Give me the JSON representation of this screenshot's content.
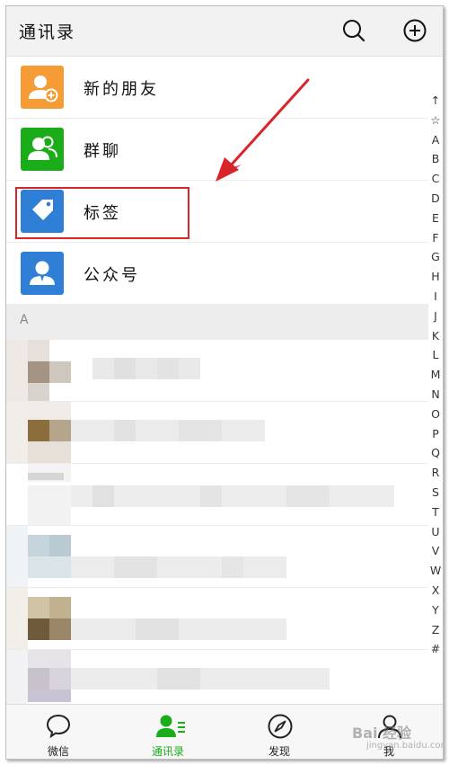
{
  "header": {
    "title": "通讯录",
    "search_icon": "search-icon",
    "add_icon": "plus-circle-icon"
  },
  "functions": [
    {
      "label": "新的朋友",
      "icon": "add-friend-icon",
      "color": "#f69c34"
    },
    {
      "label": "群聊",
      "icon": "group-chat-icon",
      "color": "#1aad19"
    },
    {
      "label": "标签",
      "icon": "tag-icon",
      "color": "#2f7fd6"
    },
    {
      "label": "公众号",
      "icon": "official-account-icon",
      "color": "#2f7fd6"
    }
  ],
  "section": {
    "letter": "A"
  },
  "index_letters": [
    "↑",
    "☆",
    "A",
    "B",
    "C",
    "D",
    "E",
    "F",
    "G",
    "H",
    "I",
    "J",
    "K",
    "L",
    "M",
    "N",
    "O",
    "P",
    "Q",
    "R",
    "S",
    "T",
    "U",
    "V",
    "W",
    "X",
    "Y",
    "Z",
    "#"
  ],
  "tabs": [
    {
      "label": "微信",
      "icon": "chat-bubble-icon",
      "active": false
    },
    {
      "label": "通讯录",
      "icon": "contacts-icon",
      "active": true
    },
    {
      "label": "发现",
      "icon": "compass-icon",
      "active": false
    },
    {
      "label": "我",
      "icon": "me-icon",
      "active": false
    }
  ],
  "watermark": {
    "line1": "Bai 经验",
    "line2": "jingyan.baidu.com"
  },
  "colors": {
    "accent": "#1aad19",
    "annotation": "#d9252a"
  }
}
